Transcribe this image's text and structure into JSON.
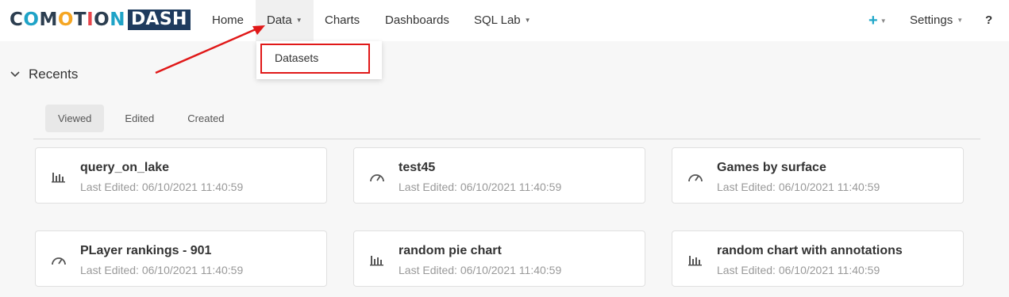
{
  "logo": {
    "word": "COMOTION",
    "box": "DASH",
    "letter_colors": [
      "#2c3e50",
      "#1fa3c7",
      "#2c3e50",
      "#f5a623",
      "#2c3e50",
      "#e8454b",
      "#2c3e50",
      "#1fa3c7"
    ]
  },
  "nav": {
    "home": "Home",
    "data": "Data",
    "charts": "Charts",
    "dashboards": "Dashboards",
    "sql_lab": "SQL Lab",
    "plus": "+",
    "settings": "Settings",
    "help": "?"
  },
  "dropdown": {
    "datasets": "Datasets"
  },
  "recents": {
    "title": "Recents",
    "tabs": [
      {
        "label": "Viewed",
        "active": true
      },
      {
        "label": "Edited",
        "active": false
      },
      {
        "label": "Created",
        "active": false
      }
    ]
  },
  "cards": [
    {
      "title": "query_on_lake",
      "subtitle": "Last Edited: 06/10/2021 11:40:59",
      "icon": "bar-chart-icon"
    },
    {
      "title": "test45",
      "subtitle": "Last Edited: 06/10/2021 11:40:59",
      "icon": "dashboard-gauge-icon"
    },
    {
      "title": "Games by surface",
      "subtitle": "Last Edited: 06/10/2021 11:40:59",
      "icon": "dashboard-gauge-icon"
    },
    {
      "title": "PLayer rankings - 901",
      "subtitle": "Last Edited: 06/10/2021 11:40:59",
      "icon": "dashboard-gauge-icon"
    },
    {
      "title": "random pie chart",
      "subtitle": "Last Edited: 06/10/2021 11:40:59",
      "icon": "bar-chart-icon"
    },
    {
      "title": "random chart with annotations",
      "subtitle": "Last Edited: 06/10/2021 11:40:59",
      "icon": "bar-chart-icon"
    }
  ],
  "colors": {
    "annotation_red": "#e01818",
    "plus_teal": "#20a7c9",
    "logo_box": "#1f3b5e"
  }
}
